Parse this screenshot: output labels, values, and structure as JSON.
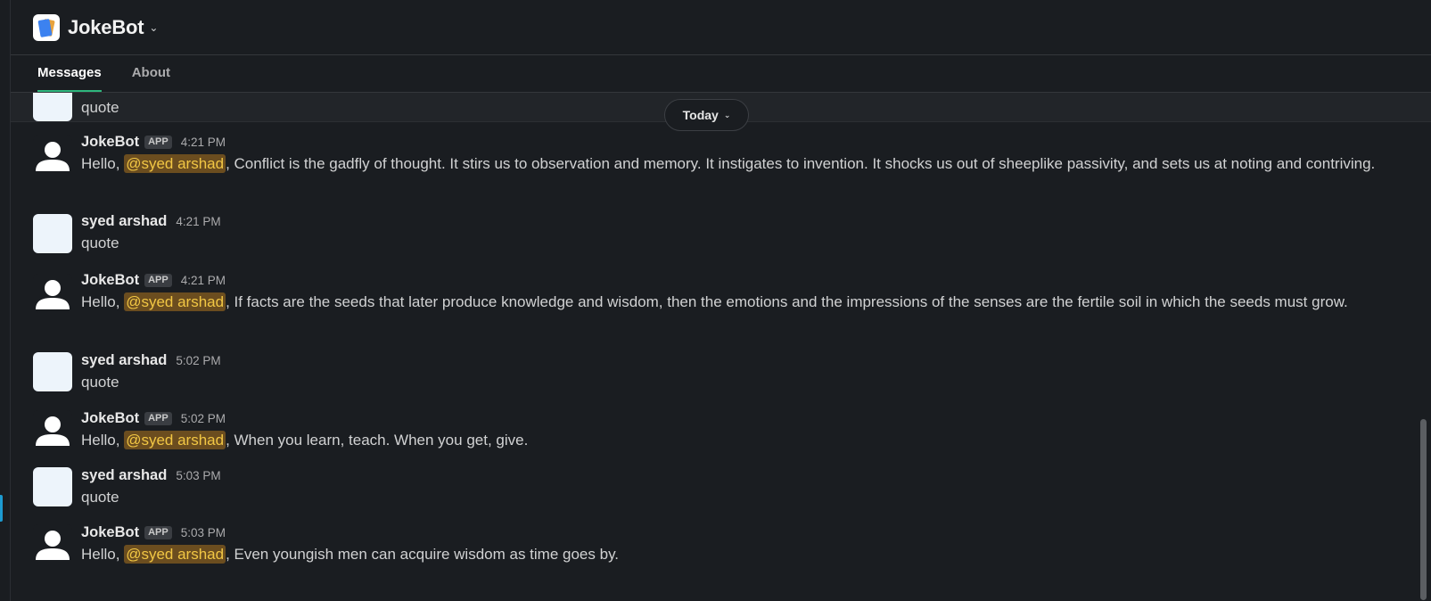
{
  "app": {
    "title": "JokeBot",
    "logo_icon": "jokebot-cards-logo",
    "title_icon": "chevron-down-icon"
  },
  "tabs": [
    {
      "label": "Messages",
      "active": true
    },
    {
      "label": "About",
      "active": false
    }
  ],
  "day_divider": {
    "label": "Today"
  },
  "colors": {
    "background": "#1a1d21",
    "mention_bg": "#6b4d1f",
    "mention_text": "#f2c744",
    "active_tab_underline": "#2eb67d"
  },
  "partial_message": {
    "text": "quote"
  },
  "messages": [
    {
      "sender": "JokeBot",
      "badge": "APP",
      "time": "4:21 PM",
      "prefix": "Hello, ",
      "mention": "@syed arshad",
      "text": ", Conflict is the gadfly of thought. It stirs us to observation and memory. It instigates to invention. It shocks us out of sheeplike passivity, and sets us at noting and contriving."
    },
    {
      "sender": "syed arshad",
      "time": "4:21 PM",
      "text": "quote"
    },
    {
      "sender": "JokeBot",
      "badge": "APP",
      "time": "4:21 PM",
      "prefix": "Hello, ",
      "mention": "@syed arshad",
      "text": ", If facts are the seeds that later produce knowledge and wisdom, then the emotions and the impressions of the senses are the fertile soil in which the seeds must grow."
    },
    {
      "sender": "syed arshad",
      "time": "5:02 PM",
      "text": "quote"
    },
    {
      "sender": "JokeBot",
      "badge": "APP",
      "time": "5:02 PM",
      "prefix": "Hello, ",
      "mention": "@syed arshad",
      "text": ", When you learn, teach. When you get, give."
    },
    {
      "sender": "syed arshad",
      "time": "5:03 PM",
      "text": "quote"
    },
    {
      "sender": "JokeBot",
      "badge": "APP",
      "time": "5:03 PM",
      "prefix": "Hello, ",
      "mention": "@syed arshad",
      "text": ", Even youngish men can acquire wisdom as time goes by."
    }
  ]
}
